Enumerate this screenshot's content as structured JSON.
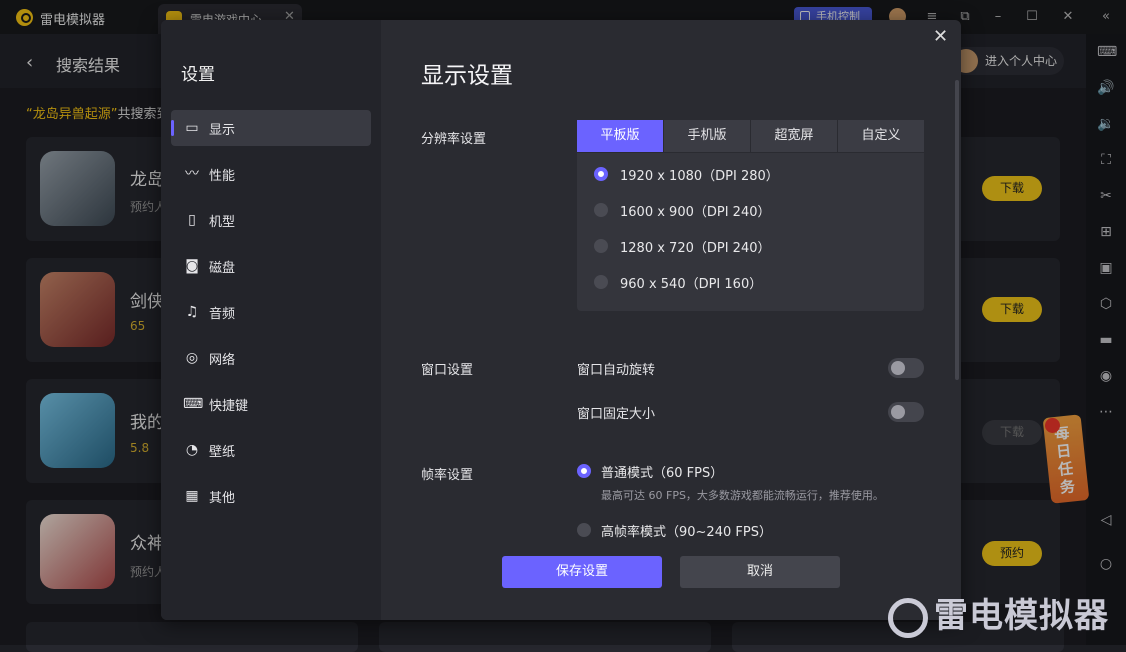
{
  "app": {
    "name": "雷电模拟器",
    "tab_label": "雷电游戏中心",
    "phone_control": "手机控制"
  },
  "header": {
    "title": "搜索结果",
    "personal_center": "进入个人中心"
  },
  "results": {
    "keyword": "“龙岛异兽起源”",
    "suffix": "共搜索到"
  },
  "games": [
    {
      "name": "龙岛",
      "sub": "预约人",
      "button": "下载",
      "art": "dragon-island-icon"
    },
    {
      "name": "剑侠",
      "sub": "65",
      "button": "下载",
      "art": "swordsman-icon"
    },
    {
      "name": "我的",
      "sub": "5.8",
      "button": "下载",
      "art": "my-game-icon"
    },
    {
      "name": "众神",
      "sub": "预约人",
      "button": "预约",
      "art": "gods-icon"
    }
  ],
  "settings": {
    "nav_title": "设置",
    "nav": [
      {
        "label": "显示",
        "icon": "monitor-icon"
      },
      {
        "label": "性能",
        "icon": "performance-icon"
      },
      {
        "label": "机型",
        "icon": "device-model-icon"
      },
      {
        "label": "磁盘",
        "icon": "disk-icon"
      },
      {
        "label": "音频",
        "icon": "audio-icon"
      },
      {
        "label": "网络",
        "icon": "network-icon"
      },
      {
        "label": "快捷键",
        "icon": "keyboard-icon"
      },
      {
        "label": "壁纸",
        "icon": "palette-icon"
      },
      {
        "label": "其他",
        "icon": "grid-icon"
      }
    ],
    "title": "显示设置",
    "resolution": {
      "label": "分辨率设置",
      "tabs": [
        "平板版",
        "手机版",
        "超宽屏",
        "自定义"
      ],
      "options": [
        "1920 x 1080（DPI 280）",
        "1600 x 900（DPI 240）",
        "1280 x 720（DPI 240）",
        "960 x 540（DPI 160）"
      ],
      "selected": "1920 x 1080（DPI 280）"
    },
    "window": {
      "label": "窗口设置",
      "auto_rotate": "窗口自动旋转",
      "fixed_size": "窗口固定大小"
    },
    "fps": {
      "label": "帧率设置",
      "normal": "普通模式（60 FPS）",
      "normal_desc": "最高可达 60 FPS，大多数游戏都能流畅运行，推荐使用。",
      "high": "高帧率模式（90~240 FPS）"
    },
    "save": "保存设置",
    "cancel": "取消"
  },
  "task_badge": "每日任务",
  "watermark": "雷电模拟器",
  "colors": {
    "accent": "#6b63ff",
    "brand_yellow": "#f1c71a",
    "panel": "#2a2b31"
  }
}
